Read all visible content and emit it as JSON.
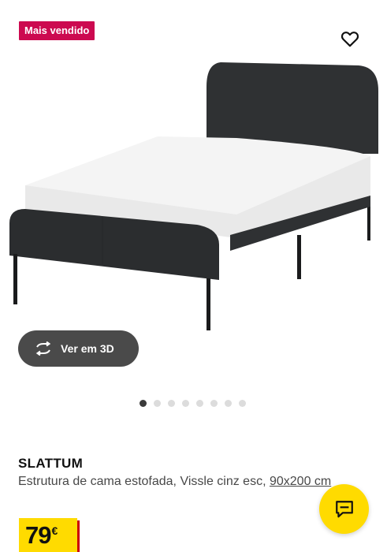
{
  "badge": {
    "label": "Mais vendido",
    "color": "#cc0a50"
  },
  "favorite": {
    "icon": "heart-icon"
  },
  "gallery": {
    "view3d_label": "Ver em 3D",
    "view3d_icon": "rotate-icon",
    "total_images": 8,
    "active_index": 1
  },
  "product": {
    "name": "SLATTUM",
    "description": "Estrutura de cama estofada, Vissle cinz esc, ",
    "size": "90x200 cm",
    "price": "79",
    "currency": "€"
  },
  "chat": {
    "icon": "chat-icon"
  },
  "colors": {
    "accent": "#ffdb00",
    "price_shadow": "#cc0008"
  }
}
